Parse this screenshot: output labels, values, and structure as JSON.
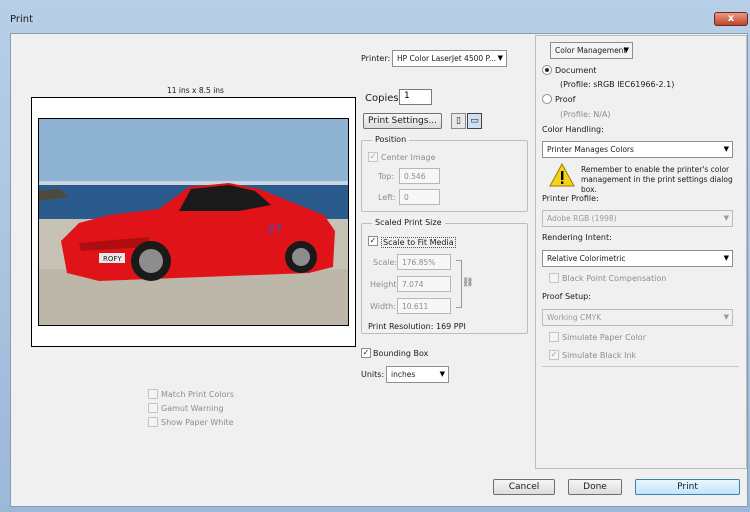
{
  "window": {
    "title": "Print",
    "close": "x"
  },
  "preview": {
    "size_label": "11 ins x 8.5 ins",
    "car_plate": "ROFY"
  },
  "printer": {
    "label": "Printer:",
    "value": "HP Color LaserJet 4500 P..."
  },
  "copies": {
    "label": "Copies:",
    "value": "1"
  },
  "print_settings_label": "Print Settings...",
  "position": {
    "title": "Position",
    "center_image": "Center Image",
    "top_label": "Top:",
    "top_value": "0.546",
    "left_label": "Left:",
    "left_value": "0"
  },
  "scaled": {
    "title": "Scaled Print Size",
    "scale_to_fit": "Scale to Fit Media",
    "scale_label": "Scale:",
    "scale_value": "176.85%",
    "height_label": "Height:",
    "height_value": "7.074",
    "width_label": "Width:",
    "width_value": "10.611",
    "resolution": "Print Resolution: 169 PPI"
  },
  "bounding_box": "Bounding Box",
  "units": {
    "label": "Units:",
    "value": "inches"
  },
  "left_options": [
    "Match Print Colors",
    "Gamut Warning",
    "Show Paper White"
  ],
  "color_mgmt": {
    "dropdown": "Color Management",
    "document": "Document",
    "document_profile": "(Profile: sRGB IEC61966-2.1)",
    "proof": "Proof",
    "proof_profile": "(Profile: N/A)",
    "handling_label": "Color Handling:",
    "handling_value": "Printer Manages Colors",
    "warning": "Remember to enable the printer's color management in the print settings dialog box.",
    "profile_label": "Printer Profile:",
    "profile_value": "Adobe RGB (1998)",
    "intent_label": "Rendering Intent:",
    "intent_value": "Relative Colorimetric",
    "black_point": "Black Point Compensation",
    "proof_setup_label": "Proof Setup:",
    "proof_setup_value": "Working CMYK",
    "simulate_paper": "Simulate Paper Color",
    "simulate_black": "Simulate Black Ink"
  },
  "buttons": {
    "cancel": "Cancel",
    "done": "Done",
    "print": "Print"
  }
}
